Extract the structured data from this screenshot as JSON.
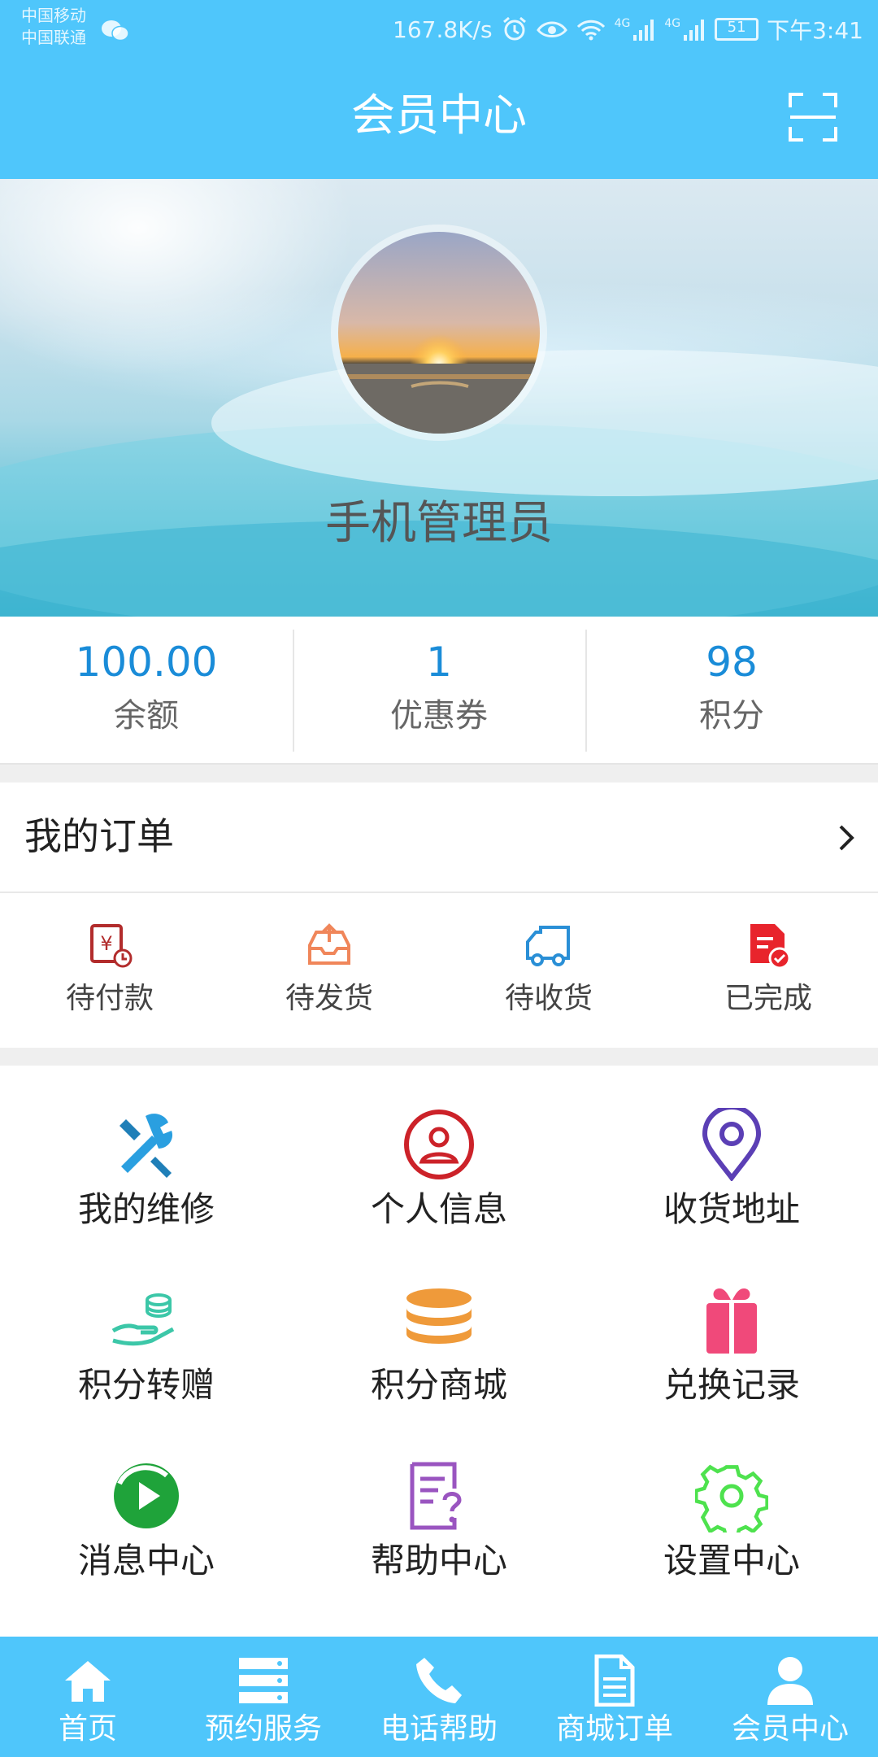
{
  "status_bar": {
    "carrier_1": "中国移动",
    "carrier_2": "中国联通",
    "speed": "167.8K/s",
    "net_1": "4G",
    "net_2": "4G",
    "battery": "51",
    "time": "下午3:41"
  },
  "header": {
    "title": "会员中心",
    "scan_icon": "scan-icon"
  },
  "profile": {
    "username": "手机管理员"
  },
  "stats": [
    {
      "value": "100.00",
      "label": "余额"
    },
    {
      "value": "1",
      "label": "优惠券"
    },
    {
      "value": "98",
      "label": "积分"
    }
  ],
  "orders": {
    "title": "我的订单",
    "items": [
      {
        "label": "待付款",
        "icon": "pending-payment-icon",
        "color": "#b22c2c"
      },
      {
        "label": "待发货",
        "icon": "pending-shipment-icon",
        "color": "#f0865a"
      },
      {
        "label": "待收货",
        "icon": "truck-icon",
        "color": "#2a8fd6"
      },
      {
        "label": "已完成",
        "icon": "completed-icon",
        "color": "#e8242c"
      }
    ]
  },
  "menu": [
    {
      "label": "我的维修",
      "icon": "tools-icon",
      "color": "#2a9fe0"
    },
    {
      "label": "个人信息",
      "icon": "user-circle-icon",
      "color": "#cc2229"
    },
    {
      "label": "收货地址",
      "icon": "location-pin-icon",
      "color": "#5b3fb5"
    },
    {
      "label": "积分转赠",
      "icon": "hand-coins-icon",
      "color": "#3cc7a8"
    },
    {
      "label": "积分商城",
      "icon": "coin-stack-icon",
      "color": "#ef9a3a"
    },
    {
      "label": "兑换记录",
      "icon": "gift-icon",
      "color": "#f0497a"
    },
    {
      "label": "消息中心",
      "icon": "play-circle-icon",
      "color": "#1fa33a"
    },
    {
      "label": "帮助中心",
      "icon": "help-doc-icon",
      "color": "#9a55c0"
    },
    {
      "label": "设置中心",
      "icon": "gear-icon",
      "color": "#4ee24e"
    }
  ],
  "tabbar": [
    {
      "label": "首页",
      "icon": "home-icon"
    },
    {
      "label": "预约服务",
      "icon": "server-list-icon"
    },
    {
      "label": "电话帮助",
      "icon": "phone-icon"
    },
    {
      "label": "商城订单",
      "icon": "document-icon"
    },
    {
      "label": "会员中心",
      "icon": "person-icon"
    }
  ],
  "colors": {
    "primary": "#4fc6fb",
    "stat_value": "#1a8cd8"
  }
}
